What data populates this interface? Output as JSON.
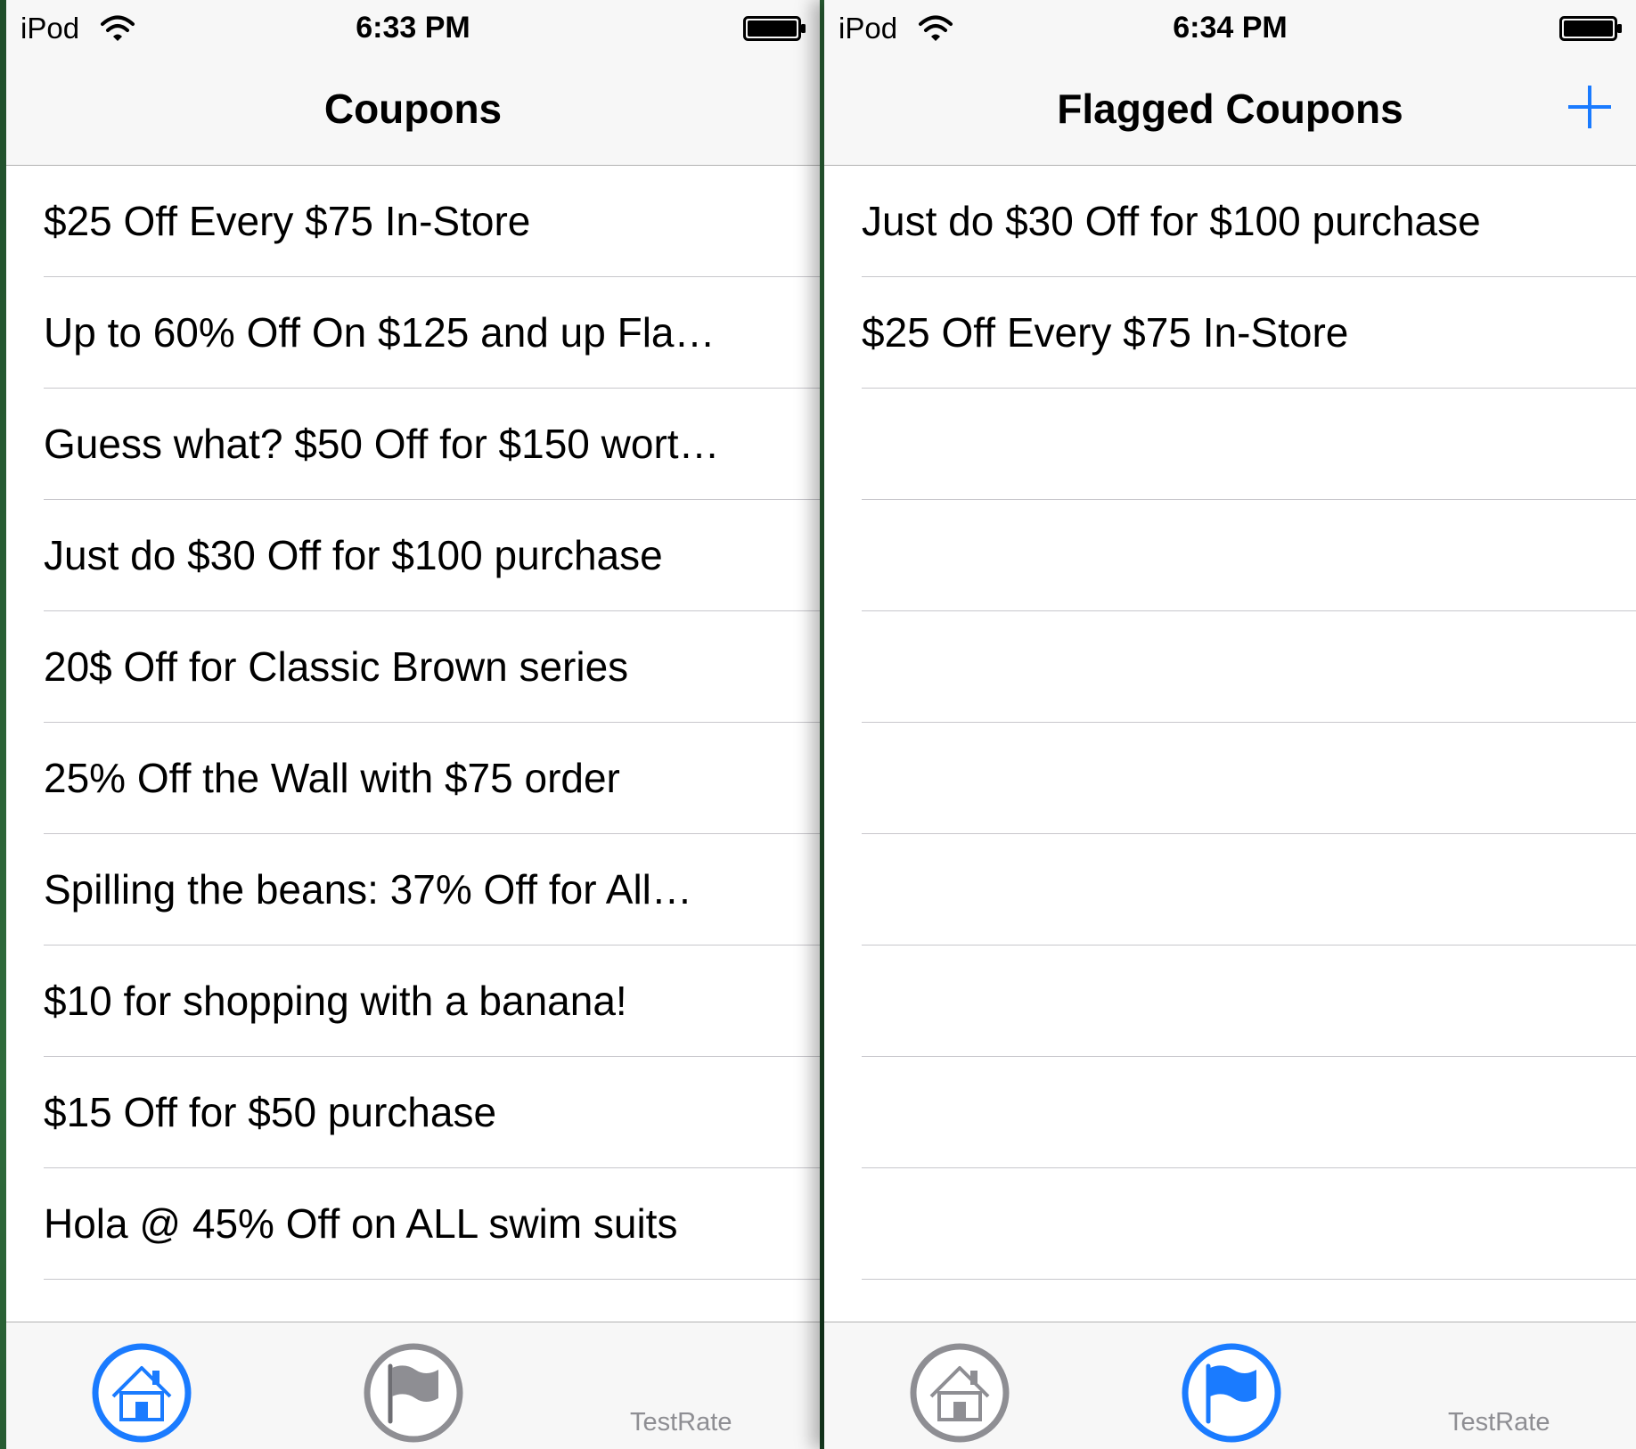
{
  "colors": {
    "tint": "#1a7bff",
    "inactive_tab": "#8e8e93",
    "separator": "#c8c7cc",
    "bar_background": "#f7f7f7"
  },
  "screens": [
    {
      "status": {
        "carrier": "iPod",
        "time": "6:33 PM",
        "wifi_icon": "wifi-icon",
        "battery_icon": "battery-icon"
      },
      "nav": {
        "title": "Coupons",
        "has_add": false
      },
      "rows": [
        "$25 Off Every $75 In-Store",
        "Up to 60% Off On $125 and up Fla…",
        "Guess what? $50 Off for $150 wort…",
        "Just do $30 Off for $100 purchase",
        "20$ Off for Classic Brown series",
        "25% Off the Wall with $75 order",
        "Spilling the beans: 37% Off for All…",
        "$10 for shopping with a banana!",
        "$15 Off for $50 purchase",
        "Hola @ 45% Off on ALL swim suits"
      ],
      "tabbar": {
        "tabs": [
          {
            "icon": "home-icon",
            "selected": true
          },
          {
            "icon": "flag-icon",
            "selected": false
          }
        ],
        "label": "TestRate"
      }
    },
    {
      "status": {
        "carrier": "iPod",
        "time": "6:34 PM",
        "wifi_icon": "wifi-icon",
        "battery_icon": "battery-icon"
      },
      "nav": {
        "title": "Flagged Coupons",
        "has_add": true,
        "add_icon": "plus-icon"
      },
      "rows": [
        "Just do $30 Off for $100 purchase",
        "$25 Off Every $75 In-Store",
        "",
        "",
        "",
        "",
        "",
        "",
        "",
        ""
      ],
      "tabbar": {
        "tabs": [
          {
            "icon": "home-icon",
            "selected": false
          },
          {
            "icon": "flag-icon",
            "selected": true
          }
        ],
        "label": "TestRate"
      }
    }
  ]
}
